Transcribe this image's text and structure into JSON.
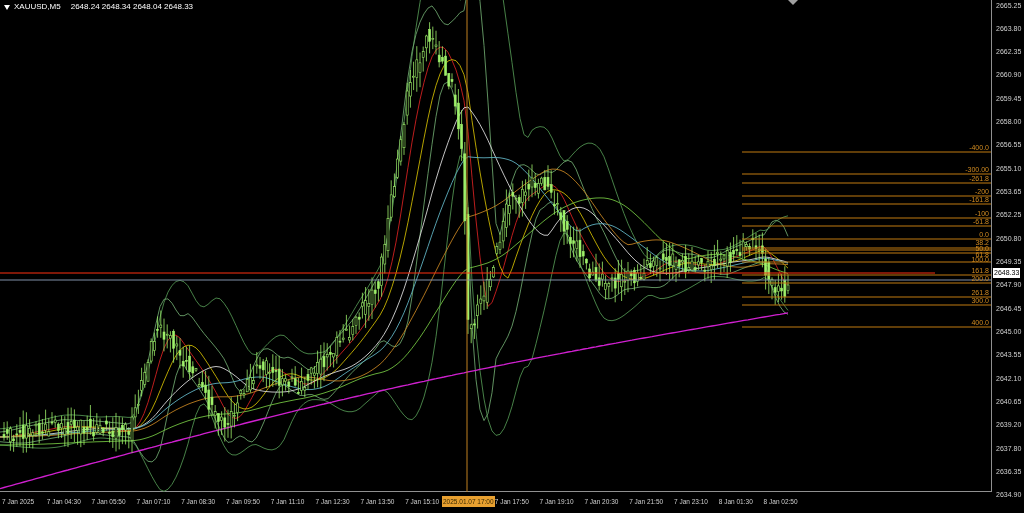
{
  "chart": {
    "symbol": "XAUUSD,M5",
    "quotes": "2648.24 2648.34 2648.04 2648.33",
    "price_labels": [
      "2665.25",
      "2663.80",
      "2662.35",
      "2660.90",
      "2659.45",
      "2658.00",
      "2656.55",
      "2655.10",
      "2653.65",
      "2652.25",
      "2650.80",
      "2649.35",
      "2647.90",
      "2646.45",
      "2645.00",
      "2643.55",
      "2642.10",
      "2640.65",
      "2639.20",
      "2637.80",
      "2636.35",
      "2634.90"
    ],
    "current_price": "2648.33",
    "time_labels": [
      "7 Jan 2025",
      "7 Jan 04:30",
      "7 Jan 05:50",
      "7 Jan 07:10",
      "7 Jan 08:30",
      "7 Jan 09:50",
      "7 Jan 11:10",
      "7 Jan 12:30",
      "7 Jan 13:50",
      "7 Jan 15:10",
      "7 Jan 17:50",
      "7 Jan 19:10",
      "7 Jan 20:30",
      "7 Jan 21:50",
      "7 Jan 23:10",
      "8 Jan 01:30",
      "8 Jan 02:50"
    ],
    "crosshair_time": "2025.01.07 17:00",
    "fib_levels": [
      {
        "label": "-400.0"
      },
      {
        "label": "-300.00"
      },
      {
        "label": "-261.8"
      },
      {
        "label": "-200"
      },
      {
        "label": "-161.8"
      },
      {
        "label": "-100"
      },
      {
        "label": "-61.8"
      },
      {
        "label": "0.0"
      },
      {
        "label": "38.2"
      },
      {
        "label": "50.0"
      },
      {
        "label": "61.8"
      },
      {
        "label": "100.0"
      },
      {
        "label": "161.8"
      },
      {
        "label": "200.0"
      },
      {
        "label": "261.8"
      },
      {
        "label": "300.0"
      },
      {
        "label": "400.0"
      }
    ]
  }
}
